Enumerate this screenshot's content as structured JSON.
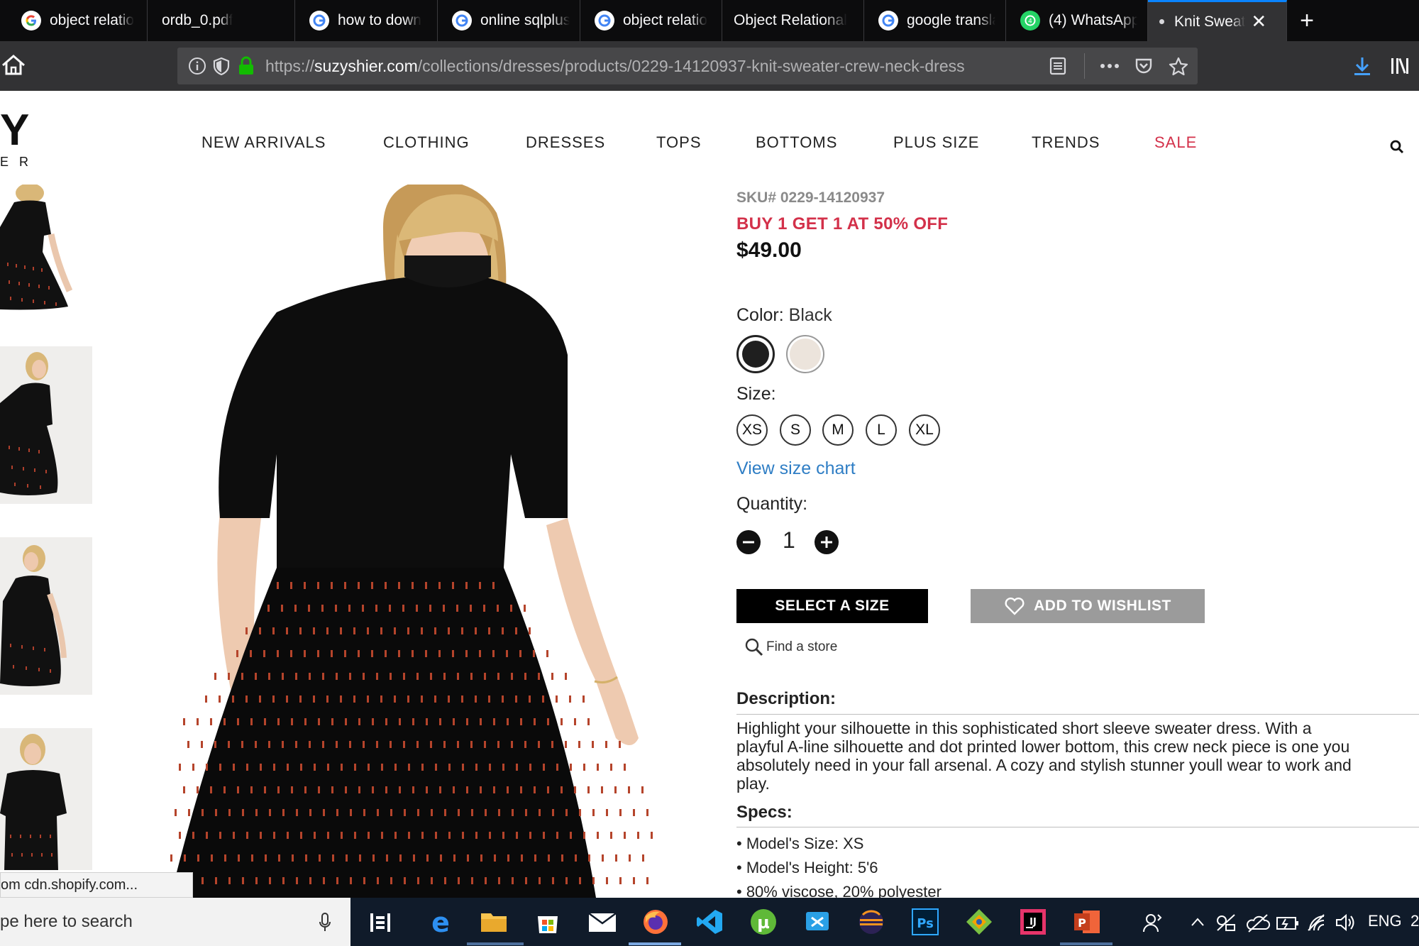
{
  "browser": {
    "tabs": [
      {
        "label": "object relatio",
        "icon": "google-icon"
      },
      {
        "label": "ordb_0.pdf",
        "icon": ""
      },
      {
        "label": "how to down",
        "icon": "google-icon"
      },
      {
        "label": "online sqlplus",
        "icon": "google-icon"
      },
      {
        "label": "object relatio",
        "icon": "google-icon"
      },
      {
        "label": "Object Relational",
        "icon": ""
      },
      {
        "label": "google transla",
        "icon": "google-icon"
      },
      {
        "label": "(4) WhatsApp",
        "icon": "whatsapp-icon"
      },
      {
        "label": "Knit Sweat",
        "icon": "",
        "active": true
      }
    ],
    "url_prefix": "https://",
    "url_domain": "suzyshier.com",
    "url_path": "/collections/dresses/products/0229-14120937-knit-sweater-crew-neck-dress"
  },
  "site": {
    "logo_letter": "Y",
    "logo_sub": "E R",
    "nav": [
      "NEW ARRIVALS",
      "CLOTHING",
      "DRESSES",
      "TOPS",
      "BOTTOMS",
      "PLUS SIZE",
      "TRENDS",
      "SALE"
    ]
  },
  "product": {
    "sku": "SKU# 0229-14120937",
    "promo": "BUY 1 GET 1 AT 50% OFF",
    "price": "$49.00",
    "color_label": "Color:",
    "color_value": "Black",
    "colors": [
      "#1f1f1f",
      "#ece4dc"
    ],
    "size_label": "Size:",
    "sizes": [
      "XS",
      "S",
      "M",
      "L",
      "XL"
    ],
    "size_chart_link": "View size chart",
    "quantity_label": "Quantity:",
    "quantity": "1",
    "select_size_button": "SELECT A SIZE",
    "wishlist_button": "ADD TO WISHLIST",
    "find_store": "Find a store",
    "description_label": "Description:",
    "description_lines": [
      "Highlight your silhouette in this sophisticated short sleeve sweater dress. With a",
      "playful A-line silhouette and dot printed lower bottom, this crew neck piece is one you",
      "absolutely need in your fall arsenal. A cozy and stylish stunner youll wear to work and",
      "play."
    ],
    "specs_label": "Specs:",
    "specs": [
      "• Model's Size: XS",
      "• Model's Height: 5'6",
      "• 80% viscose, 20% polyester"
    ]
  },
  "status_bar": "om cdn.shopify.com...",
  "taskbar": {
    "search_text": "pe here to search",
    "lang": "ENG",
    "clock_fragment": "2"
  }
}
